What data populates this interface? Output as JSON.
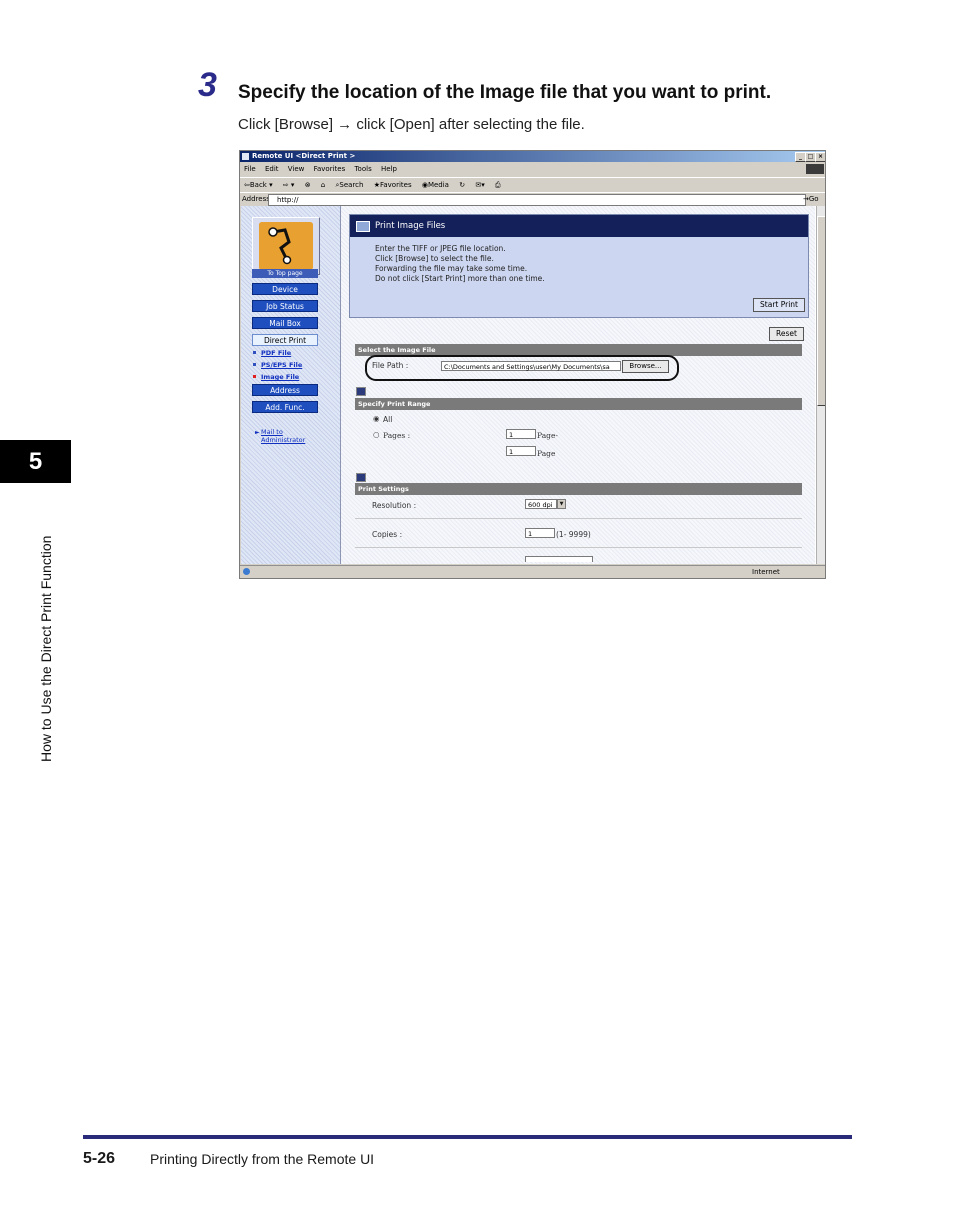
{
  "step": {
    "number": "3",
    "heading": "Specify the location of the Image file that you want to print.",
    "instruction": "Click [Browse] → click [Open] after selecting the file."
  },
  "sidebar_tab": {
    "chapter": "5",
    "caption": "How to Use the Direct Print Function"
  },
  "footer": {
    "page_number": "5-26",
    "title": "Printing Directly from the Remote UI"
  },
  "browser": {
    "title": "Remote UI <Direct Print >",
    "menu": [
      "File",
      "Edit",
      "View",
      "Favorites",
      "Tools",
      "Help"
    ],
    "toolbar": [
      "⇦Back ▾",
      "⇨ ▾",
      "⊗",
      "⌂",
      "⌕Search",
      "★Favorites",
      "◉Media",
      "↻",
      "✉▾",
      "⎙"
    ],
    "address_label": "Address",
    "address_value": "http://",
    "go_label": "→Go",
    "status_zone": "Internet"
  },
  "nav": {
    "to_top": "To Top page",
    "items": [
      "Device",
      "Job Status",
      "Mail Box",
      "Direct Print"
    ],
    "sub_links": [
      "PDF File",
      "PS/EPS File",
      "Image File"
    ],
    "items_after": [
      "Address",
      "Add. Func."
    ],
    "mail_link_line1": "Mail to",
    "mail_link_line2": "Administrator"
  },
  "panel": {
    "title": "Print Image Files",
    "instructions": [
      "Enter the TIFF or JPEG file location.",
      "Click [Browse] to select the file.",
      "Forwarding the file may take some time.",
      "Do not click [Start Print] more than one time."
    ],
    "start_print": "Start Print",
    "reset": "Reset"
  },
  "select_file": {
    "section": "Select the Image File",
    "file_path_label": "File Path :",
    "file_path_value": "C:\\Documents and Settings\\user\\My Documents\\sa",
    "browse": "Browse..."
  },
  "print_range": {
    "section": "Specify Print Range",
    "all_label": "All",
    "pages_label": "Pages :",
    "from_value": "1",
    "from_suffix": "Page-",
    "to_value": "1",
    "to_suffix": "Page"
  },
  "print_settings": {
    "section": "Print Settings",
    "resolution_label": "Resolution :",
    "resolution_value": "600 dpi",
    "copies_label": "Copies :",
    "copies_value": "1",
    "copies_range": "(1- 9999)"
  },
  "colors": {
    "heading_accent": "#2a2a8a",
    "nav_button": "#1f4fbf",
    "panel_header": "#14205a",
    "section_bar": "#7a7a7a"
  }
}
